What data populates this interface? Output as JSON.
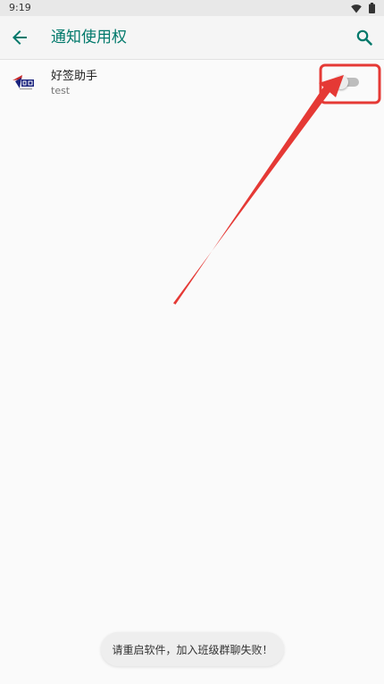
{
  "status_bar": {
    "time": "9:19",
    "icons": [
      "wifi-icon",
      "battery-icon"
    ]
  },
  "app_bar": {
    "back_icon": "arrow-back-icon",
    "title": "通知使用权",
    "search_icon": "search-icon"
  },
  "apps": [
    {
      "name": "好签助手",
      "subtitle": "test",
      "icon": "haoqian-app-icon",
      "notification_access_enabled": false
    }
  ],
  "toast": {
    "message": "请重启软件，加入班级群聊失败！"
  },
  "colors": {
    "accent": "#00796b",
    "annotation_red": "#e53935",
    "background": "#fafafa"
  }
}
